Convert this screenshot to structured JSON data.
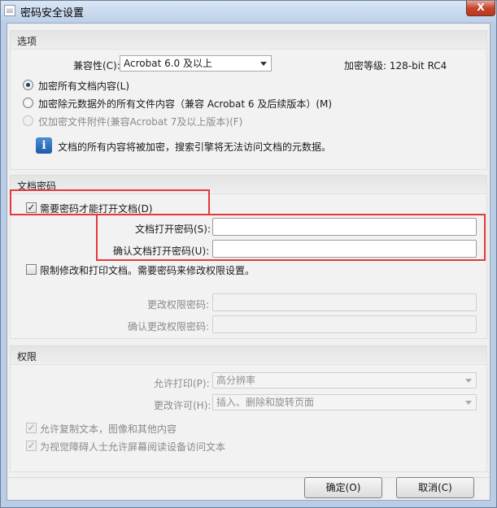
{
  "window": {
    "title": "密码安全设置",
    "close_glyph": "X"
  },
  "options": {
    "title": "选项",
    "compat_label": "兼容性(C):",
    "compat_value": "Acrobat 6.0 及以上",
    "encryption_level": "加密等级: 128-bit RC4",
    "radio_all": "加密所有文档内容(L)",
    "radio_except_metadata": "加密除元数据外的所有文件内容（兼容 Acrobat 6 及后续版本）(M)",
    "radio_attachments": "仅加密文件附件(兼容Acrobat 7及以上版本)(F)",
    "info_text": "文档的所有内容将被加密，搜索引擎将无法访问文档的元数据。"
  },
  "doc_password": {
    "title": "文档密码",
    "require_label": "需要密码才能打开文档(D)",
    "open_password_label": "文档打开密码(S):",
    "confirm_open_password_label": "确认文档打开密码(U):",
    "restrict_label": "限制修改和打印文档。需要密码来修改权限设置。",
    "perm_password_label": "更改权限密码:",
    "confirm_perm_password_label": "确认更改权限密码:"
  },
  "permissions": {
    "title": "权限",
    "print_label": "允许打印(P):",
    "print_value": "高分辨率",
    "change_label": "更改许可(H):",
    "change_value": "插入、删除和旋转页面",
    "copy_label": "允许复制文本，图像和其他内容",
    "accessibility_label": "为视觉障碍人士允许屏幕阅读设备访问文本"
  },
  "buttons": {
    "ok": "确定(O)",
    "cancel": "取消(C)"
  },
  "colors": {
    "highlight": "#e5383b",
    "accent": "#1c5aa8"
  }
}
